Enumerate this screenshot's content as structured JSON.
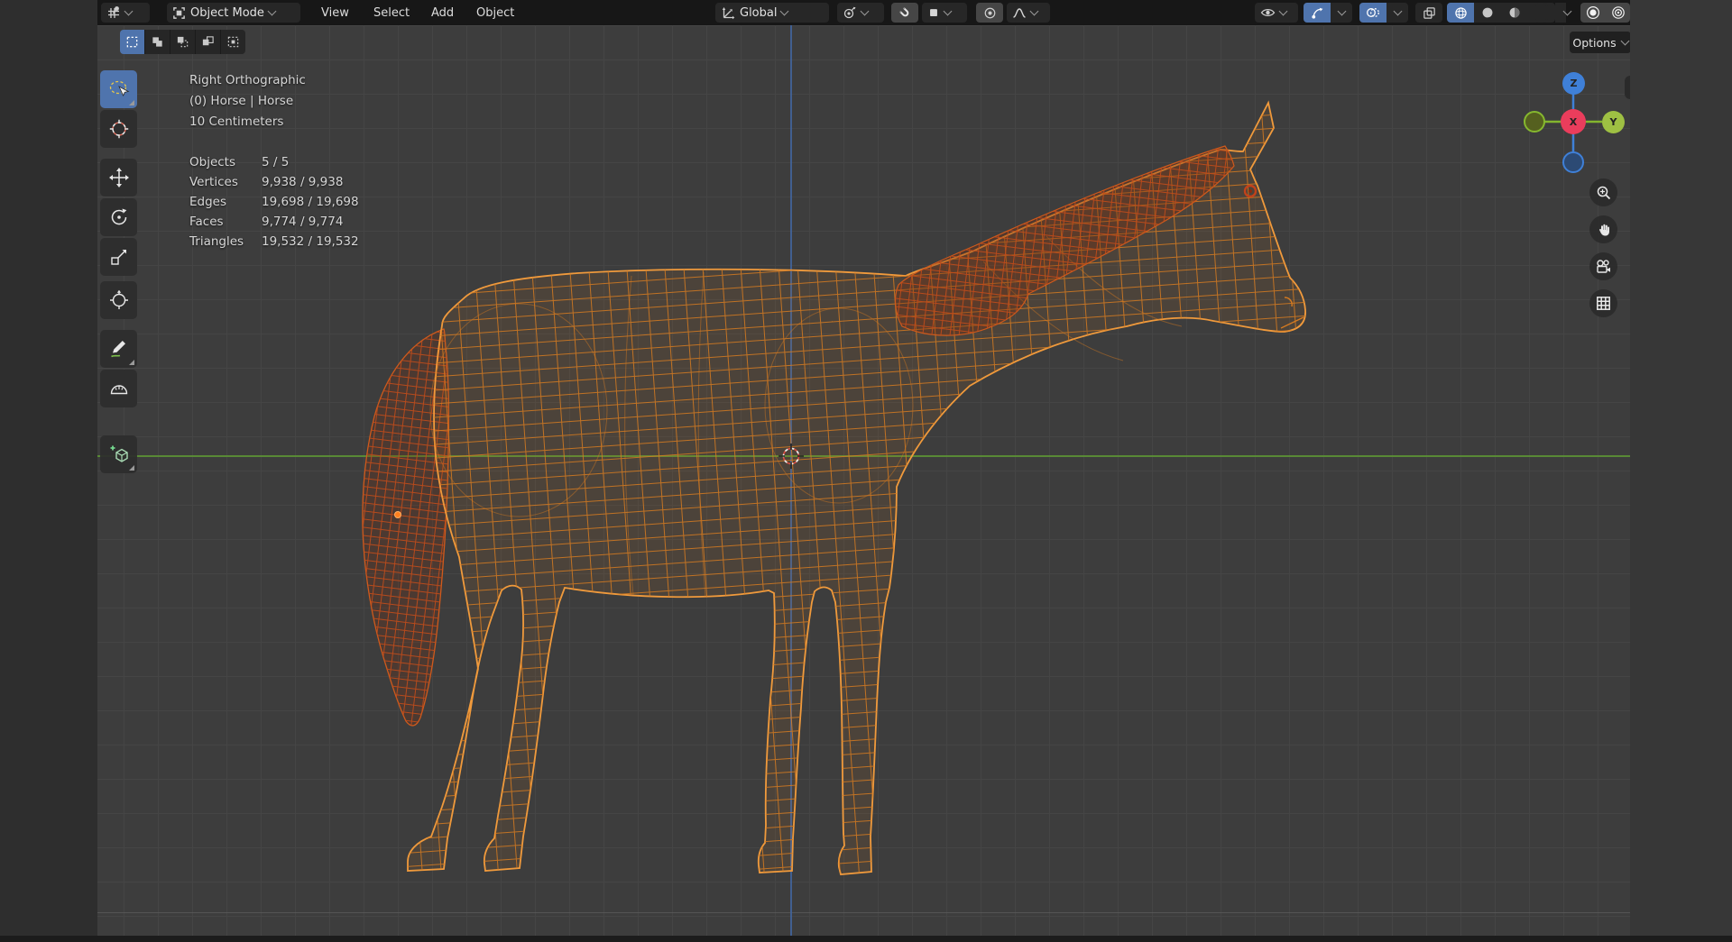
{
  "header": {
    "editor_icon": "3d-viewport-editor-icon",
    "mode_icon": "object-mode-icon",
    "mode_label": "Object Mode",
    "menus": [
      "View",
      "Select",
      "Add",
      "Object"
    ],
    "orientation_icon": "transform-orientation-icon",
    "orientation_label": "Global",
    "pivot_icon": "pivot-point-icon",
    "snap_icon": "magnet-icon",
    "snap_target_icon": "snap-target-icon",
    "proportional_icon": "proportional-editing-icon",
    "falloff_icon": "falloff-curve-icon",
    "visibility_icon": "object-visibility-icon",
    "gizmos_icon": "gizmos-icon",
    "overlays_icon": "overlays-icon",
    "xray_icon": "xray-icon",
    "shading_modes": [
      "wireframe",
      "solid",
      "material-preview",
      "rendered"
    ],
    "shading_active": "wireframe",
    "extra_toggles": [
      "circle-filled-icon",
      "circle-ring-icon"
    ]
  },
  "tool_settings": {
    "select_modes": [
      "set",
      "extend",
      "subtract",
      "invert",
      "intersect"
    ],
    "select_mode_active": "set",
    "options_label": "Options"
  },
  "toolbar": {
    "tools": [
      "select-box",
      "cursor",
      "move",
      "rotate",
      "scale",
      "transform",
      "annotate",
      "measure",
      "add-cube"
    ],
    "active_tool": "select-box"
  },
  "viewport": {
    "view_label": "Right Orthographic",
    "active_object_label": "(0) Horse | Horse",
    "grid_scale_label": "10 Centimeters",
    "stats": [
      {
        "label": "Objects",
        "value": "5 / 5"
      },
      {
        "label": "Vertices",
        "value": "9,938 / 9,938"
      },
      {
        "label": "Edges",
        "value": "19,698 / 19,698"
      },
      {
        "label": "Faces",
        "value": "9,774 / 9,774"
      },
      {
        "label": "Triangles",
        "value": "19,532 / 19,532"
      }
    ]
  },
  "nav_gizmo": {
    "z_label": "Z",
    "x_label": "X",
    "y_label": "Y"
  },
  "side_buttons": [
    "zoom-icon",
    "pan-hand-icon",
    "camera-view-icon",
    "grid-ortho-icon"
  ],
  "colors": {
    "selection_blue": "#4f74ad",
    "wire_orange": "#e07c1e",
    "wire_outline": "#f09a3c",
    "wire_red": "#c24c1a",
    "axis_y_green": "#5d9634",
    "axis_z_blue": "#42659f",
    "gizmo_x_red": "#ea3d5c",
    "gizmo_y_green": "#9ec043",
    "gizmo_z_blue": "#3f80d8",
    "viewport_bg": "#3d3d3d",
    "header_bg": "#171717"
  }
}
